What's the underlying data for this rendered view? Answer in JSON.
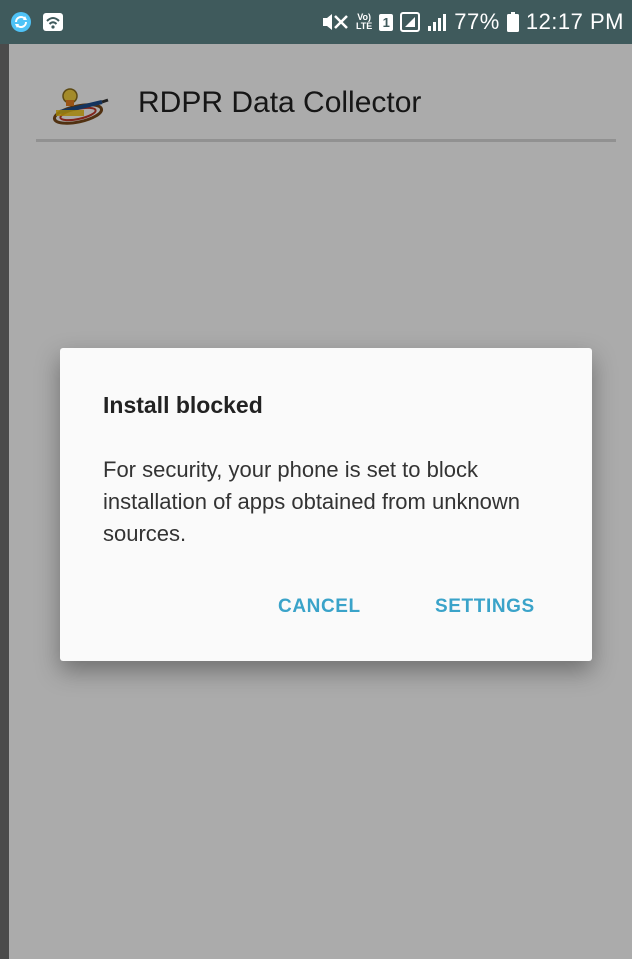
{
  "status_bar": {
    "battery_percent": "77%",
    "time": "12:17 PM",
    "lte_top": "Vo)",
    "lte_bottom": "LTE",
    "sim_label": "1",
    "icons": [
      "sync-icon",
      "wifi-icon",
      "mute-icon",
      "volte-lte-icon",
      "sim-icon",
      "signal-icon",
      "signal-bars-icon",
      "battery-icon"
    ]
  },
  "app_bar": {
    "title": "RDPR Data Collector",
    "logo": "app-logo-icon"
  },
  "dialog": {
    "title": "Install blocked",
    "message": "For security, your phone is set to block installation of apps obtained from unknown sources.",
    "cancel_label": "CANCEL",
    "settings_label": "SETTINGS"
  },
  "colors": {
    "status_bar": "#3f5a5c",
    "accent": "#3aa3c9",
    "dialog_bg": "#fafafa",
    "scrim": "rgba(0,0,0,0.33)"
  }
}
